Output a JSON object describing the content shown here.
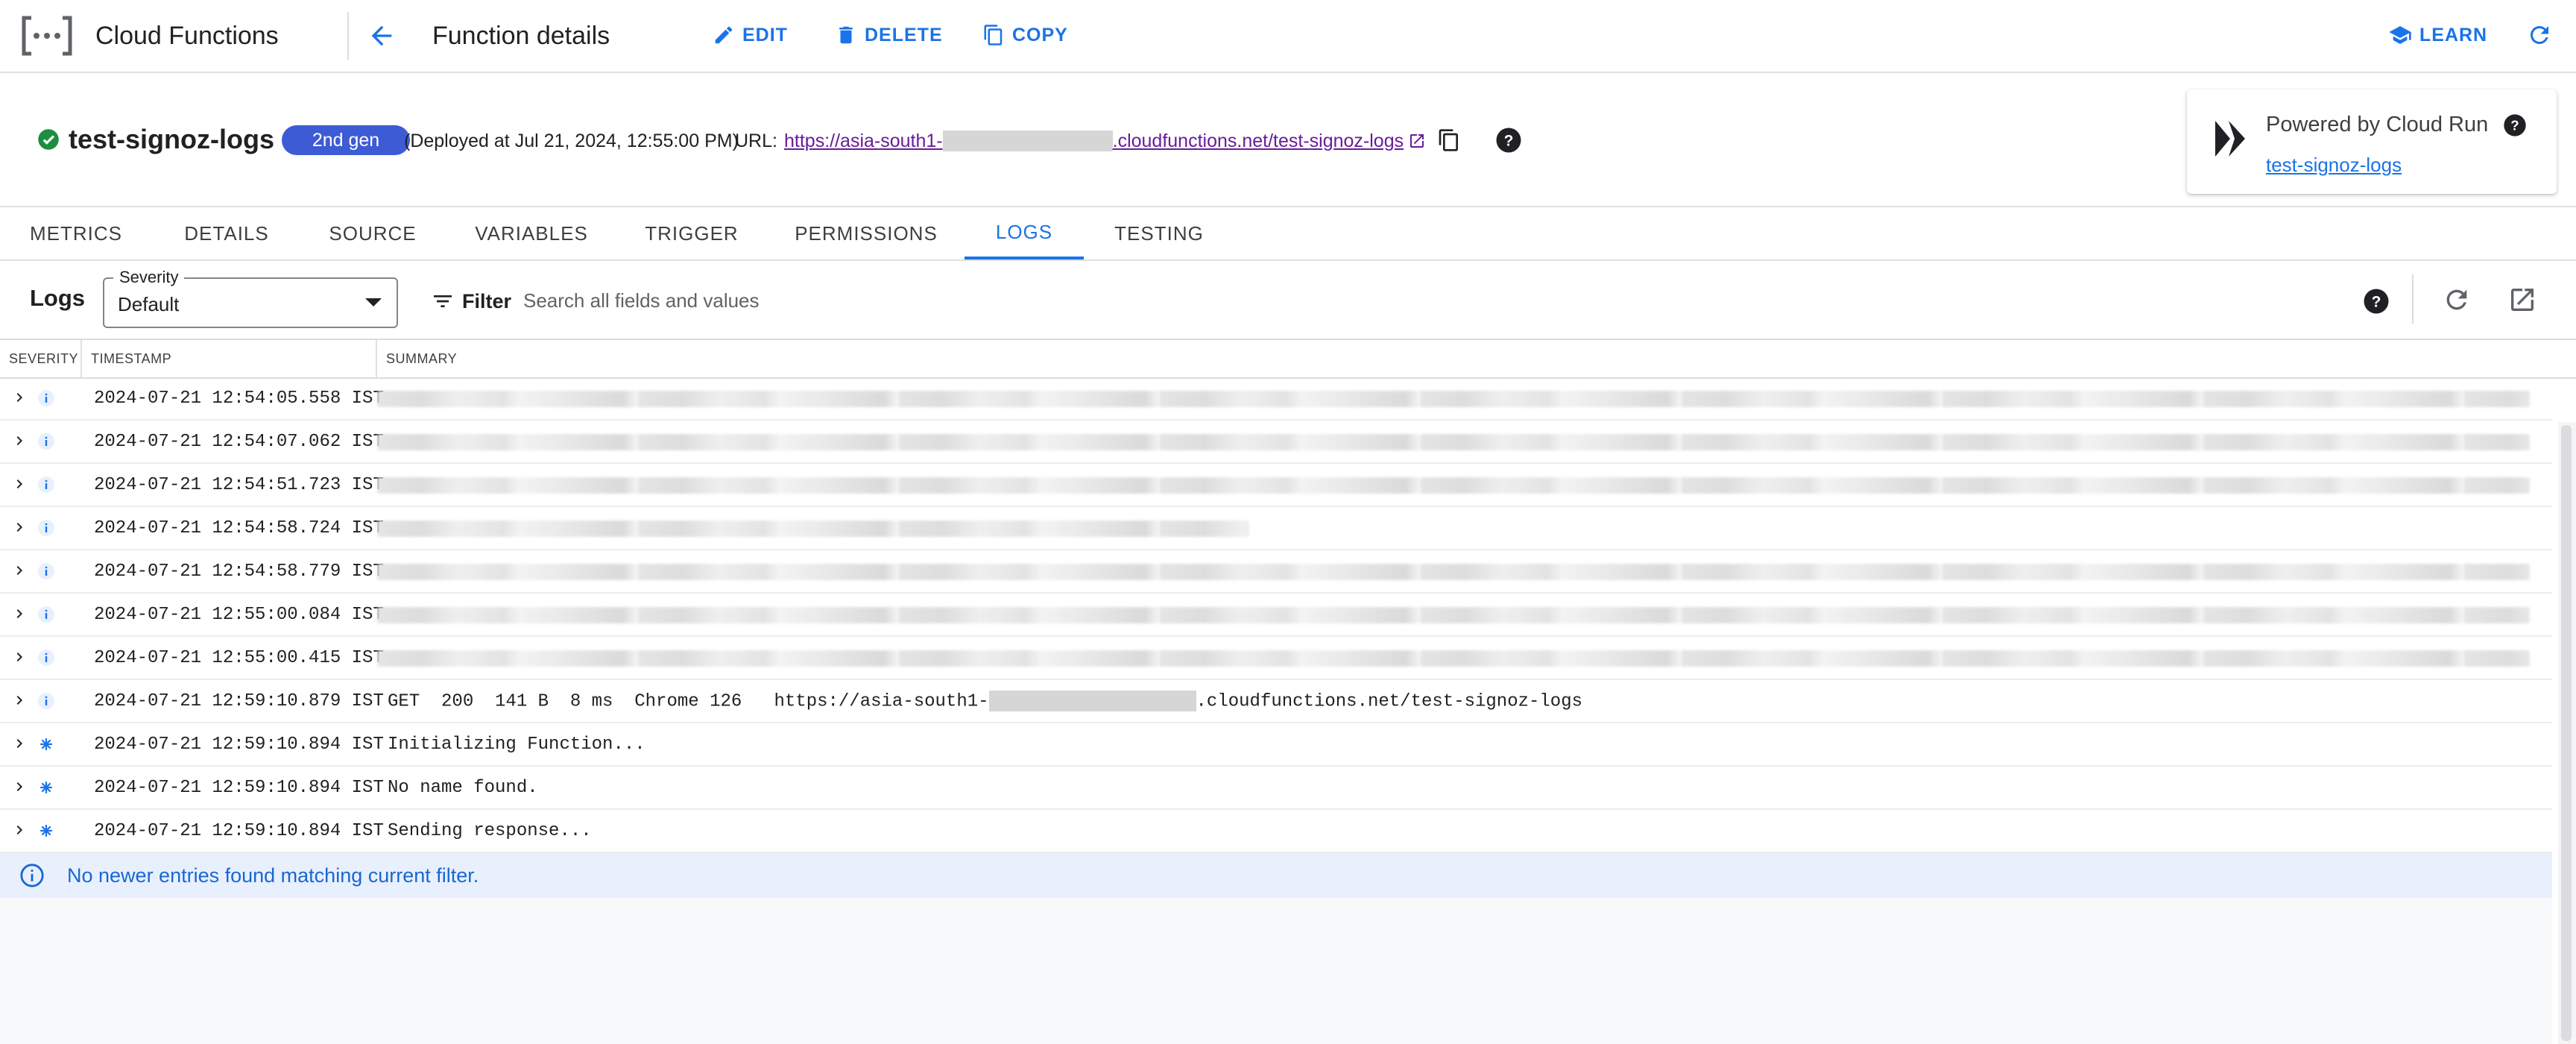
{
  "app": {
    "product_name": "Cloud Functions",
    "page_title": "Function details",
    "actions": {
      "edit": "EDIT",
      "delete": "DELETE",
      "copy": "COPY",
      "learn": "LEARN"
    }
  },
  "function": {
    "name": "test-signoz-logs",
    "generation_badge": "2nd gen",
    "deployed_text": "(Deployed at Jul 21, 2024, 12:55:00 PM)",
    "url_label": "URL:",
    "url_prefix": "https://asia-south1-",
    "url_suffix": ".cloudfunctions.net/test-signoz-logs",
    "status": "deployed"
  },
  "cloud_run": {
    "title": "Powered by Cloud Run",
    "service_link": "test-signoz-logs"
  },
  "tabs": [
    {
      "label": "METRICS",
      "active": false
    },
    {
      "label": "DETAILS",
      "active": false
    },
    {
      "label": "SOURCE",
      "active": false
    },
    {
      "label": "VARIABLES",
      "active": false
    },
    {
      "label": "TRIGGER",
      "active": false
    },
    {
      "label": "PERMISSIONS",
      "active": false
    },
    {
      "label": "LOGS",
      "active": true
    },
    {
      "label": "TESTING",
      "active": false
    }
  ],
  "logs_toolbar": {
    "title": "Logs",
    "severity_label": "Severity",
    "severity_value": "Default",
    "filter_label": "Filter",
    "search_placeholder": "Search all fields and values"
  },
  "table": {
    "columns": {
      "severity": "SEVERITY",
      "timestamp": "TIMESTAMP",
      "summary": "SUMMARY"
    }
  },
  "logs": [
    {
      "severity": "info",
      "timestamp": "2024-07-21 12:54:05.558 IST",
      "summary": null,
      "redacted": true
    },
    {
      "severity": "info",
      "timestamp": "2024-07-21 12:54:07.062 IST",
      "summary": null,
      "redacted": true
    },
    {
      "severity": "info",
      "timestamp": "2024-07-21 12:54:51.723 IST",
      "summary": null,
      "redacted": true
    },
    {
      "severity": "info",
      "timestamp": "2024-07-21 12:54:58.724 IST",
      "summary": null,
      "redacted": true
    },
    {
      "severity": "info",
      "timestamp": "2024-07-21 12:54:58.779 IST",
      "summary": null,
      "redacted": true
    },
    {
      "severity": "info",
      "timestamp": "2024-07-21 12:55:00.084 IST",
      "summary": null,
      "redacted": true
    },
    {
      "severity": "info",
      "timestamp": "2024-07-21 12:55:00.415 IST",
      "summary": null,
      "redacted": true
    },
    {
      "severity": "info",
      "timestamp": "2024-07-21 12:59:10.879 IST",
      "summary_prefix": "GET  200  141 B  8 ms  Chrome 126   https://asia-south1-",
      "summary_suffix": ".cloudfunctions.net/test-signoz-logs",
      "request": true
    },
    {
      "severity": "default",
      "timestamp": "2024-07-21 12:59:10.894 IST",
      "summary": "Initializing Function..."
    },
    {
      "severity": "default",
      "timestamp": "2024-07-21 12:59:10.894 IST",
      "summary": "No name found."
    },
    {
      "severity": "default",
      "timestamp": "2024-07-21 12:59:10.894 IST",
      "summary": "Sending response..."
    }
  ],
  "banner": {
    "text": "No newer entries found matching current filter."
  },
  "colors": {
    "accent": "#1a73e8",
    "badge": "#3d5bd5",
    "success": "#1e8e3e",
    "link_visited": "#6a1b9a",
    "banner_bg": "#e8f0fe"
  },
  "icons": {
    "product": "cloud-functions-icon",
    "back": "arrow-left-icon",
    "edit": "pencil-icon",
    "delete": "trash-icon",
    "copy": "copy-icon",
    "learn": "graduation-cap-icon",
    "refresh": "refresh-icon",
    "status": "check-circle-icon",
    "help": "help-circle-icon",
    "filter": "filter-lines-icon",
    "open_external": "open-in-new-icon",
    "info": "info-icon"
  }
}
